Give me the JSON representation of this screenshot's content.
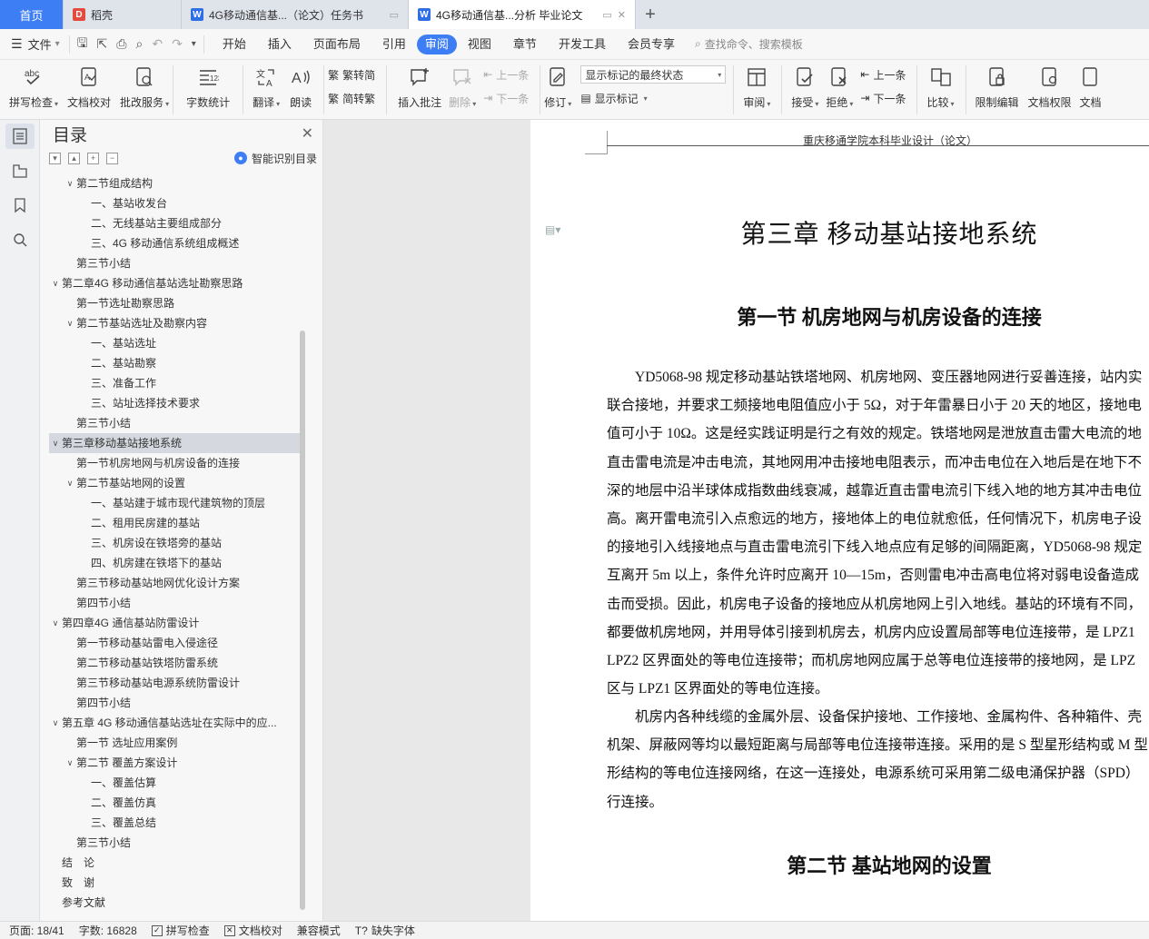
{
  "tabs": [
    {
      "label": "首页",
      "kind": "home"
    },
    {
      "label": "稻壳",
      "kind": "wps"
    },
    {
      "label": "4G移动通信基...（论文）任务书",
      "kind": "doc"
    },
    {
      "label": "4G移动通信基...分析 毕业论文",
      "kind": "doc-active"
    }
  ],
  "menu": {
    "file_label": "文件",
    "tabs": [
      "开始",
      "插入",
      "页面布局",
      "引用",
      "审阅",
      "视图",
      "章节",
      "开发工具",
      "会员专享"
    ],
    "active_tab": "审阅",
    "search_placeholder": "查找命令、搜索模板"
  },
  "ribbon": {
    "spell_check": "拼写检查",
    "doc_proof": "文档校对",
    "annotate_service": "批改服务",
    "word_count": "字数统计",
    "translate": "翻译",
    "read_aloud": "朗读",
    "trad_to_simp": "繁转简",
    "simp_to_trad": "简转繁",
    "insert_comment": "插入批注",
    "delete": "删除",
    "prev_comment": "上一条",
    "next_comment": "下一条",
    "revise": "修订",
    "markup_state": "显示标记的最终状态",
    "show_markup": "显示标记",
    "review": "审阅",
    "accept": "接受",
    "reject": "拒绝",
    "prev_change": "上一条",
    "next_change": "下一条",
    "compare": "比较",
    "restrict_edit": "限制编辑",
    "doc_permission": "文档权限",
    "doc_more": "文档"
  },
  "toc": {
    "title": "目录",
    "smart_label": "智能识别目录",
    "items": [
      {
        "text": "第二节组成结构",
        "level": 2,
        "toggle": "open"
      },
      {
        "text": "一、基站收发台",
        "level": 3
      },
      {
        "text": "二、无线基站主要组成部分",
        "level": 3
      },
      {
        "text": "三、4G 移动通信系统组成概述",
        "level": 3
      },
      {
        "text": "第三节小结",
        "level": 2
      },
      {
        "text": "第二章4G 移动通信基站选址勘察思路",
        "level": 1,
        "toggle": "open"
      },
      {
        "text": "第一节选址勘察思路",
        "level": 2
      },
      {
        "text": "第二节基站选址及勘察内容",
        "level": 2,
        "toggle": "open"
      },
      {
        "text": "一、基站选址",
        "level": 3
      },
      {
        "text": "二、基站勘察",
        "level": 3
      },
      {
        "text": "三、准备工作",
        "level": 3
      },
      {
        "text": "三、站址选择技术要求",
        "level": 3
      },
      {
        "text": "第三节小结",
        "level": 2
      },
      {
        "text": "第三章移动基站接地系统",
        "level": 1,
        "toggle": "open",
        "selected": true
      },
      {
        "text": "第一节机房地网与机房设备的连接",
        "level": 2
      },
      {
        "text": "第二节基站地网的设置",
        "level": 2,
        "toggle": "open"
      },
      {
        "text": "一、基站建于城市现代建筑物的顶层",
        "level": 3
      },
      {
        "text": "二、租用民房建的基站",
        "level": 3
      },
      {
        "text": "三、机房设在铁塔旁的基站",
        "level": 3
      },
      {
        "text": "四、机房建在铁塔下的基站",
        "level": 3
      },
      {
        "text": "第三节移动基站地网优化设计方案",
        "level": 2
      },
      {
        "text": "第四节小结",
        "level": 2
      },
      {
        "text": "第四章4G 通信基站防雷设计",
        "level": 1,
        "toggle": "open"
      },
      {
        "text": "第一节移动基站雷电入侵途径",
        "level": 2
      },
      {
        "text": "第二节移动基站铁塔防雷系统",
        "level": 2
      },
      {
        "text": "第三节移动基站电源系统防雷设计",
        "level": 2
      },
      {
        "text": "第四节小结",
        "level": 2
      },
      {
        "text": "第五章 4G 移动通信基站选址在实际中的应...",
        "level": 1,
        "toggle": "open"
      },
      {
        "text": "第一节 选址应用案例",
        "level": 2
      },
      {
        "text": "第二节 覆盖方案设计",
        "level": 2,
        "toggle": "open"
      },
      {
        "text": "一、覆盖估算",
        "level": 3
      },
      {
        "text": "二、覆盖仿真",
        "level": 3
      },
      {
        "text": "三、覆盖总结",
        "level": 3
      },
      {
        "text": "第三节小结",
        "level": 2
      },
      {
        "text": "结　论",
        "level": 1
      },
      {
        "text": "致　谢",
        "level": 1
      },
      {
        "text": "参考文献",
        "level": 1
      }
    ]
  },
  "document": {
    "header": "重庆移通学院本科毕业设计（论文）",
    "chapter_title": "第三章  移动基站接地系统",
    "section1_title": "第一节  机房地网与机房设备的连接",
    "para1_lines": [
      "　　YD5068-98 规定移动基站铁塔地网、机房地网、变压器地网进行妥善连接，站内实",
      "联合接地，并要求工频接地电阻值应小于 5Ω，对于年雷暴日小于 20 天的地区，接地电",
      "值可小于 10Ω。这是经实践证明是行之有效的规定。铁塔地网是泄放直击雷大电流的地",
      "直击雷电流是冲击电流，其地网用冲击接地电阻表示，而冲击电位在入地后是在地下不",
      "深的地层中沿半球体成指数曲线衰减，越靠近直击雷电流引下线入地的地方其冲击电位",
      "高。离开雷电流引入点愈远的地方，接地体上的电位就愈低，任何情况下，机房电子设",
      "的接地引入线接地点与直击雷电流引下线入地点应有足够的间隔距离，YD5068-98 规定",
      "互离开 5m 以上，条件允许时应离开 10—15m，否则雷电冲击高电位将对弱电设备造成",
      "击而受损。因此，机房电子设备的接地应从机房地网上引入地线。基站的环境有不同，",
      "都要做机房地网，并用导体引接到机房去，机房内应设置局部等电位连接带，是 LPZ1",
      "LPZ2 区界面处的等电位连接带；而机房地网应属于总等电位连接带的接地网，是 LPZ",
      "区与 LPZ1 区界面处的等电位连接。"
    ],
    "para2_lines": [
      "　　机房内各种线缆的金属外层、设备保护接地、工作接地、金属构件、各种箱件、壳",
      "机架、屏蔽网等均以最短距离与局部等电位连接带连接。采用的是 S 型星形结构或 M 型",
      "形结构的等电位连接网络，在这一连接处，电源系统可采用第二级电涌保护器（SPD）",
      "行连接。"
    ],
    "section2_title": "第二节  基站地网的设置"
  },
  "status": {
    "page": "页面: 18/41",
    "words": "字数: 16828",
    "spell": "拼写检查",
    "proof": "文档校对",
    "compat": "兼容模式",
    "missing_font": "缺失字体"
  }
}
